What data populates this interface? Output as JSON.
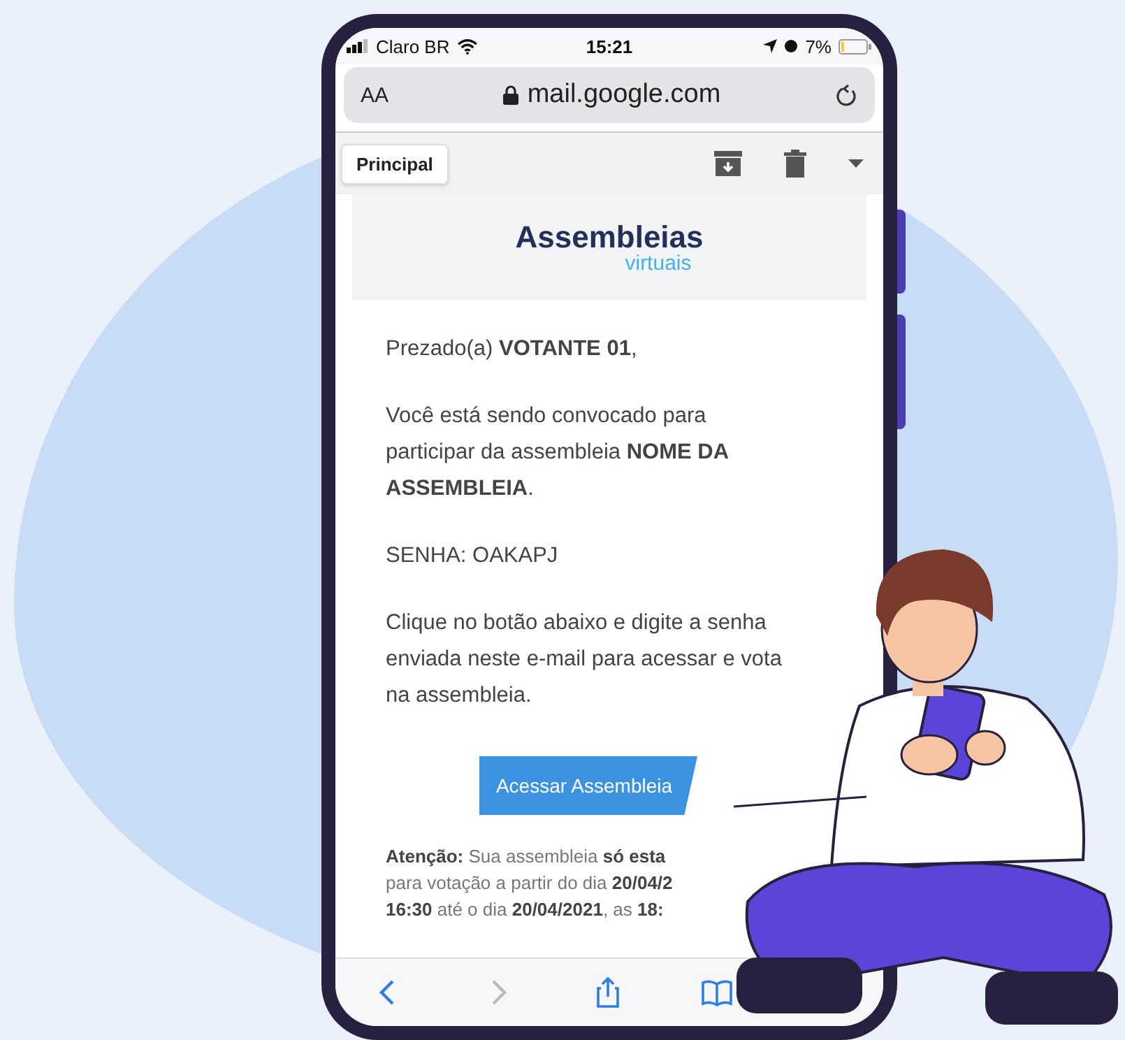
{
  "status_bar": {
    "carrier": "Claro BR",
    "time": "15:21",
    "battery": "7%"
  },
  "address_bar": {
    "text_size": "AA",
    "url": "mail.google.com"
  },
  "mail_toolbar": {
    "back_label": "Principal"
  },
  "email": {
    "logo": {
      "name": "Assembleias",
      "tagline": "virtuais"
    },
    "greeting": "Prezado(a) **VOTANTE 01**,",
    "intro": "Você está sendo convocado para participar da assembleia **NOME DA ASSEMBLEIA**.",
    "password": "SENHA: OAKAPJ",
    "instruction_lines": [
      "Clique no botão abaixo e digite a senha",
      "enviada neste e-mail para acessar e vota",
      "na assembleia."
    ],
    "button": "Acessar Assembleia",
    "notice_lines": [
      "**Atenção:** Sua assembleia **só esta**",
      "para votação a partir do dia **20/04/2**",
      "**16:30** até o dia **20/04/2021**, as **18:**"
    ]
  },
  "browser_toolbar": [
    {
      "kind": "back",
      "disabled": false
    },
    {
      "kind": "forward",
      "disabled": true
    },
    {
      "kind": "share",
      "disabled": false
    },
    {
      "kind": "bookmarks",
      "disabled": false
    }
  ]
}
